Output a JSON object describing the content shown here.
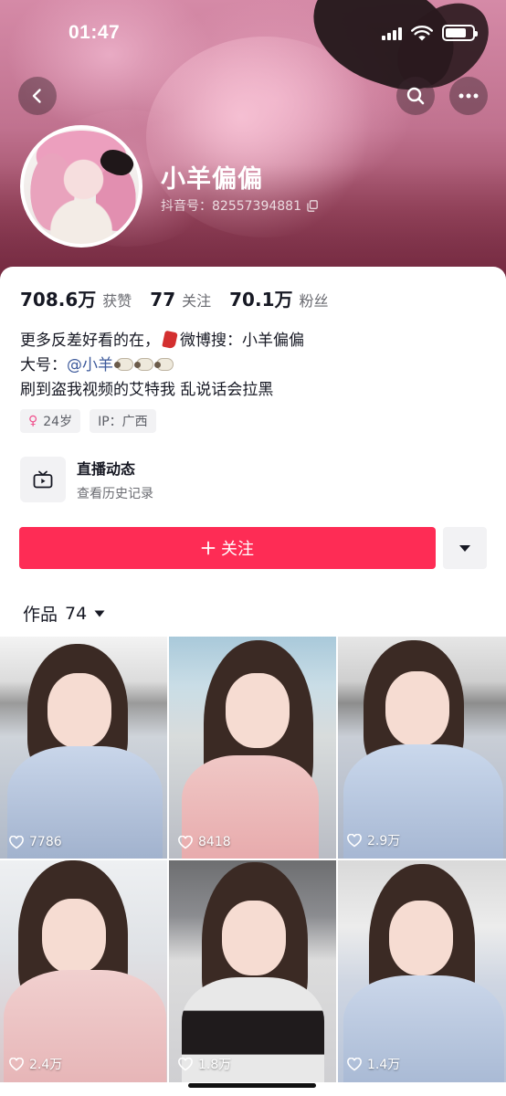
{
  "status_bar": {
    "time": "01:47",
    "battery_level": 0.8
  },
  "profile": {
    "nickname": "小羊偏偏",
    "douyin_id": "抖音号：82557394881"
  },
  "stats": [
    {
      "num": "708.6万",
      "label": "获赞"
    },
    {
      "num": "77",
      "label": "关注"
    },
    {
      "num": "70.1万",
      "label": "粉丝"
    }
  ],
  "bio": {
    "line1_a": "更多反差好看的在，",
    "line1_b": "微博搜：小羊偏偏",
    "line2_a": "大号：",
    "line2_mention": "@小羊",
    "line3": "刷到盗我视频的艾特我 乱说话会拉黑"
  },
  "tags": {
    "age": "24岁",
    "ip": "IP：广西"
  },
  "live": {
    "title": "直播动态",
    "subtitle": "查看历史记录"
  },
  "actions": {
    "follow_label": "关注"
  },
  "works": {
    "label": "作品",
    "count": "74"
  },
  "videos": [
    {
      "likes": "7786"
    },
    {
      "likes": "8418"
    },
    {
      "likes": "2.9万"
    },
    {
      "likes": "2.4万"
    },
    {
      "likes": "1.8万"
    },
    {
      "likes": "1.4万"
    }
  ],
  "colors": {
    "accent": "#fe2c55",
    "mention": "#3d5a9b"
  }
}
